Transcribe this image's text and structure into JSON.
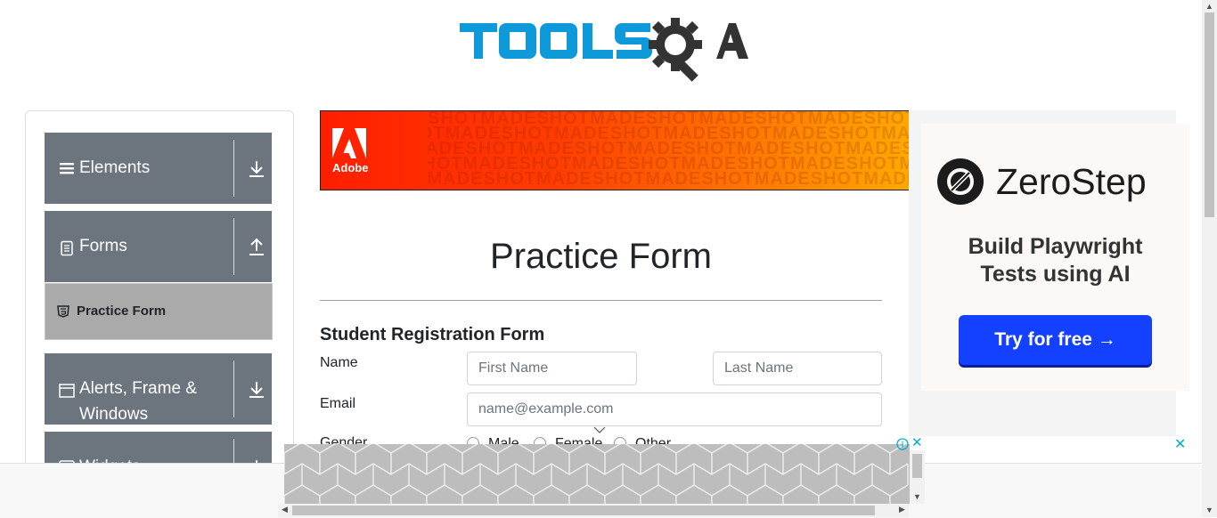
{
  "header": {
    "logo_text": "TOOLSQA"
  },
  "sidebar": {
    "groups": [
      {
        "label": "Elements",
        "icon": "hamburger-icon",
        "arrow": "download-arrow-icon"
      },
      {
        "label": "Forms",
        "icon": "document-icon",
        "arrow": "upload-arrow-icon"
      },
      {
        "label": "Alerts, Frame & Windows",
        "line1": "Alerts, Frame &",
        "line2": "Windows",
        "icon": "window-icon",
        "arrow": "download-arrow-icon"
      },
      {
        "label": "Widgets",
        "icon": "widgets-icon",
        "arrow": "download-arrow-icon"
      }
    ],
    "active_item": {
      "label": "Practice Form",
      "icon": "html5-icon"
    }
  },
  "banner_ad": {
    "brand": "Adobe",
    "pattern_text": "SHOTMADESHOTMADESHOTMADESHOTMADESHOTMADESHOTMADE"
  },
  "main": {
    "title": "Practice Form",
    "form_heading": "Student Registration Form",
    "name_label": "Name",
    "first_name_placeholder": "First Name",
    "last_name_placeholder": "Last Name",
    "email_label": "Email",
    "email_placeholder": "name@example.com",
    "gender_label": "Gender",
    "gender_options": [
      "Male",
      "Female",
      "Other"
    ]
  },
  "right_ad": {
    "brand": "ZeroStep",
    "tagline_line1": "Build Playwright",
    "tagline_line2": "Tests using AI",
    "cta": "Try for free →",
    "close": "✕"
  },
  "bottom_ad": {
    "close": "✕",
    "info": "i"
  },
  "colors": {
    "sidebar_header": "#6c757d",
    "sidebar_active": "#aaaaaa",
    "cta": "#1440ff",
    "logo_blue": "#0e9ad8",
    "logo_dark": "#333333"
  }
}
